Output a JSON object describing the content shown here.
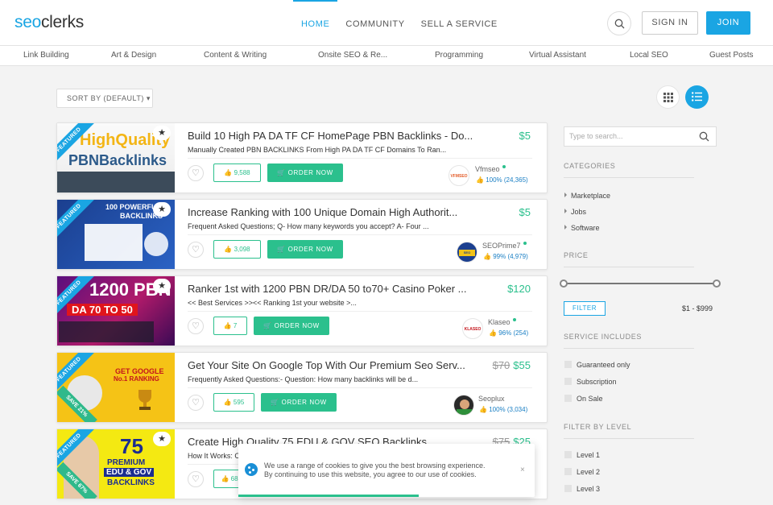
{
  "header": {
    "logo_prefix": "seo",
    "logo_suffix": "clerks",
    "nav": [
      "HOME",
      "COMMUNITY",
      "SELL A SERVICE"
    ],
    "signin": "SIGN IN",
    "join": "JOIN",
    "accent": "#1aa5e3"
  },
  "categories": [
    "Link Building",
    "Art & Design",
    "Content & Writing",
    "Onsite SEO & Re...",
    "Programming",
    "Virtual Assistant",
    "Local SEO",
    "Guest Posts"
  ],
  "toolbar": {
    "sort_label": "SORT BY (DEFAULT)"
  },
  "listings": [
    {
      "title": "Build 10 High PA DA TF CF HomePage PBN Backlinks - Do...",
      "desc": "Manually Created PBN BACKLINKS From High PA DA TF CF Domains To Ran...",
      "price": "$5",
      "old_price": "",
      "likes": "9,588",
      "order": "ORDER NOW",
      "ribbon": "FEATURED",
      "save": "",
      "thumb_l1": "HighQuality",
      "thumb_l2": "PBNBacklinks",
      "seller": "Vfmseo",
      "rating": "100% (24,365)",
      "avatar_text": "VFMSEO"
    },
    {
      "title": "Increase Ranking with 100 Unique Domain High Authorit...",
      "desc": "Frequent Asked Questions; Q- How many keywords you accept? A- Four ...",
      "price": "$5",
      "old_price": "",
      "likes": "3,098",
      "order": "ORDER NOW",
      "ribbon": "FEATURED",
      "save": "",
      "thumb_l1": "100 POWERFUL",
      "thumb_l2": "BACKLINKS",
      "seller": "SEOPrime7",
      "rating": "99% (4,979)",
      "avatar_text": "SEO PRIME"
    },
    {
      "title": "Ranker 1st with 1200 PBN DR/DA 50 to70+ Casino Poker ...",
      "desc": "<< Best Services >><< Ranking 1st your website >...",
      "price": "$120",
      "old_price": "",
      "likes": "7",
      "order": "ORDER NOW",
      "ribbon": "FEATURED",
      "save": "",
      "thumb_l1": "1200 PBN",
      "thumb_l2": "DA 70 TO 50",
      "seller": "Klaseo",
      "rating": "96% (254)",
      "avatar_text": "KLASEO"
    },
    {
      "title": "Get Your Site On Google Top With Our Premium Seo Serv...",
      "desc": "Frequently Asked Questions:- Question: How many backlinks will be d...",
      "price": "$55",
      "old_price": "$70",
      "likes": "595",
      "order": "ORDER NOW",
      "ribbon": "FEATURED",
      "save": "SAVE 21%",
      "thumb_l1": "GET GOOGLE",
      "thumb_l2": "No.1 RANKING",
      "seller": "Seoplux",
      "rating": "100% (3,034)",
      "avatar_text": ""
    },
    {
      "title": "Create High Quality 75 EDU & GOV SEO Backlinks",
      "desc": "How It Works: C",
      "price": "$25",
      "old_price": "$75",
      "likes": "68",
      "order": "ORDER NOW",
      "ribbon": "FEATURED",
      "save": "SAVE 67%",
      "thumb_l1": "75",
      "thumb_l2": "PREMIUM",
      "thumb_l3": "EDU & GOV",
      "thumb_l4": "BACKLINKS",
      "seller": "",
      "rating": "",
      "avatar_text": ""
    }
  ],
  "sidebar": {
    "search_placeholder": "Type to search...",
    "categories_title": "CATEGORIES",
    "categories": [
      "Marketplace",
      "Jobs",
      "Software"
    ],
    "price_title": "PRICE",
    "filter": "FILTER",
    "price_range": "$1 -  $999",
    "includes_title": "SERVICE INCLUDES",
    "includes": [
      "Guaranteed only",
      "Subscription",
      "On Sale"
    ],
    "level_title": "FILTER BY LEVEL",
    "levels": [
      "Level 1",
      "Level 2",
      "Level 3"
    ]
  },
  "cookie": {
    "line1": "We use a range of cookies to give you the best browsing experience.",
    "line2": "By continuing to use this website, you agree to our use of cookies.",
    "close": "×"
  }
}
